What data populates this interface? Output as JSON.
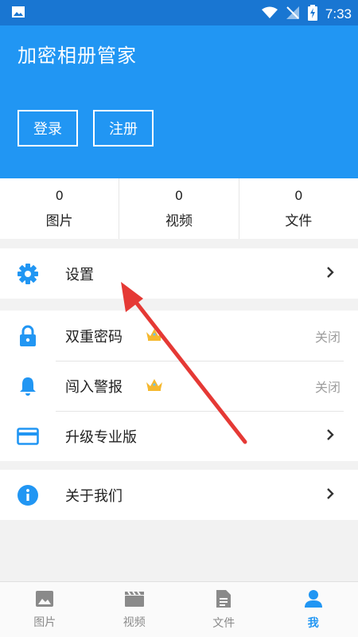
{
  "status_bar": {
    "time": "7:33"
  },
  "header": {
    "title": "加密相册管家",
    "login_label": "登录",
    "register_label": "注册"
  },
  "stats": [
    {
      "count": "0",
      "label": "图片"
    },
    {
      "count": "0",
      "label": "视频"
    },
    {
      "count": "0",
      "label": "文件"
    }
  ],
  "menu": {
    "settings": {
      "label": "设置"
    },
    "double_password": {
      "label": "双重密码",
      "value": "关闭"
    },
    "intrusion_alert": {
      "label": "闯入警报",
      "value": "关闭"
    },
    "upgrade_pro": {
      "label": "升级专业版"
    },
    "about_us": {
      "label": "关于我们"
    }
  },
  "bottom_nav": [
    {
      "label": "图片",
      "icon": "image-icon"
    },
    {
      "label": "视频",
      "icon": "clapperboard-icon"
    },
    {
      "label": "文件",
      "icon": "document-icon"
    },
    {
      "label": "我",
      "icon": "person-icon",
      "active": true
    }
  ],
  "colors": {
    "accent": "#2196f3",
    "status_bar": "#1976d2",
    "crown": "#f5b82e",
    "arrow": "#e53935"
  }
}
